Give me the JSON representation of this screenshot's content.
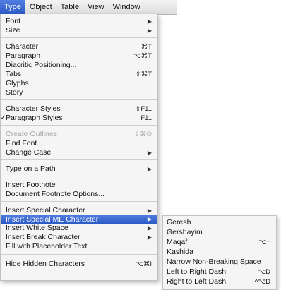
{
  "menubar": {
    "items": [
      "Type",
      "Object",
      "Table",
      "View",
      "Window"
    ]
  },
  "type_menu": {
    "items": {
      "font": {
        "label": "Font"
      },
      "size": {
        "label": "Size"
      },
      "character": {
        "label": "Character",
        "shortcut": "⌘T"
      },
      "paragraph": {
        "label": "Paragraph",
        "shortcut": "⌥⌘T"
      },
      "diacritic": {
        "label": "Diacritic Positioning..."
      },
      "tabs": {
        "label": "Tabs",
        "shortcut": "⇧⌘T"
      },
      "glyphs": {
        "label": "Glyphs"
      },
      "story": {
        "label": "Story"
      },
      "character_styles": {
        "label": "Character Styles",
        "shortcut": "⇧F11"
      },
      "paragraph_styles": {
        "label": "Paragraph Styles",
        "shortcut": "F11",
        "check": "✓"
      },
      "create_outlines": {
        "label": "Create Outlines",
        "shortcut": "⇧⌘O"
      },
      "find_font": {
        "label": "Find Font..."
      },
      "change_case": {
        "label": "Change Case"
      },
      "type_on_path": {
        "label": "Type on a Path"
      },
      "insert_footnote": {
        "label": "Insert Footnote"
      },
      "doc_footnote_options": {
        "label": "Document Footnote Options..."
      },
      "insert_special_char": {
        "label": "Insert Special Character"
      },
      "insert_special_me_char": {
        "label": "Insert Special ME Character"
      },
      "insert_white_space": {
        "label": "Insert White Space"
      },
      "insert_break_char": {
        "label": "Insert Break Character"
      },
      "fill_placeholder": {
        "label": "Fill with Placeholder Text"
      },
      "hide_hidden_chars": {
        "label": "Hide Hidden Characters",
        "shortcut": "⌥⌘I"
      }
    },
    "submenu_arrow": "▶"
  },
  "submenu": {
    "items": [
      {
        "label": "Geresh",
        "shortcut": ""
      },
      {
        "label": "Gershayim",
        "shortcut": ""
      },
      {
        "label": "Maqaf",
        "shortcut": "⌥="
      },
      {
        "label": "Kashida",
        "shortcut": ""
      },
      {
        "label": "Narrow Non-Breaking Space",
        "shortcut": ""
      },
      {
        "label": "Left to Right Dash",
        "shortcut": "⌥D"
      },
      {
        "label": "Right to Left Dash",
        "shortcut": "^⌥D"
      }
    ]
  },
  "colors": {
    "highlight": "#3565d0",
    "menu_bg": "#f5f5f5",
    "disabled_text": "#a8a8a8"
  }
}
